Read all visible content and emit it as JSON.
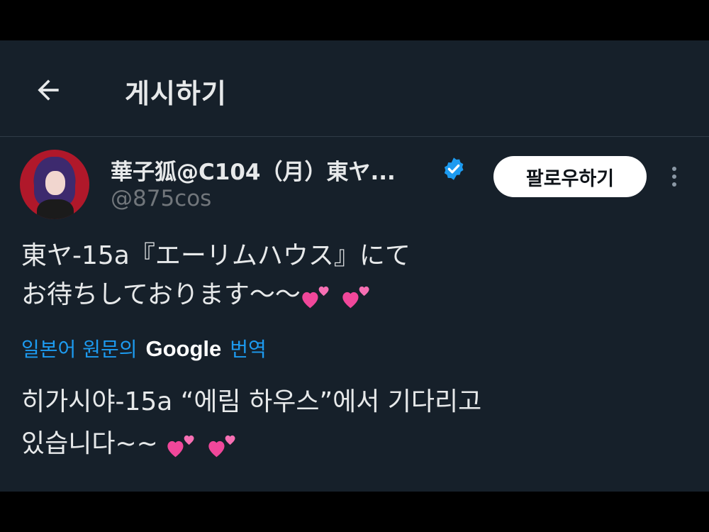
{
  "header": {
    "back_icon": "arrow-left-icon",
    "title": "게시하기"
  },
  "author": {
    "display_name": "華子狐@C104（月）東ヤ...",
    "handle": "@875cos",
    "verified_icon": "verified-badge-icon",
    "verified_color": "#1d9bf0"
  },
  "actions": {
    "follow_label": "팔로우하기",
    "more_icon": "more-vertical-icon"
  },
  "tweet": {
    "line1": "東ヤ-15a『エーリムハウス』にて",
    "line2": "お待ちしております〜〜",
    "emoji": "two-hearts"
  },
  "translation": {
    "prefix": "일본어 원문의",
    "provider": "Google",
    "suffix": "번역",
    "link_color": "#1d9bf0",
    "line1": "히가시야-15a “에림 하우스”에서 기다리고",
    "line2": "있습니다~~"
  },
  "colors": {
    "background": "#16202a",
    "text": "#e7e9ea",
    "muted": "#71767b"
  }
}
